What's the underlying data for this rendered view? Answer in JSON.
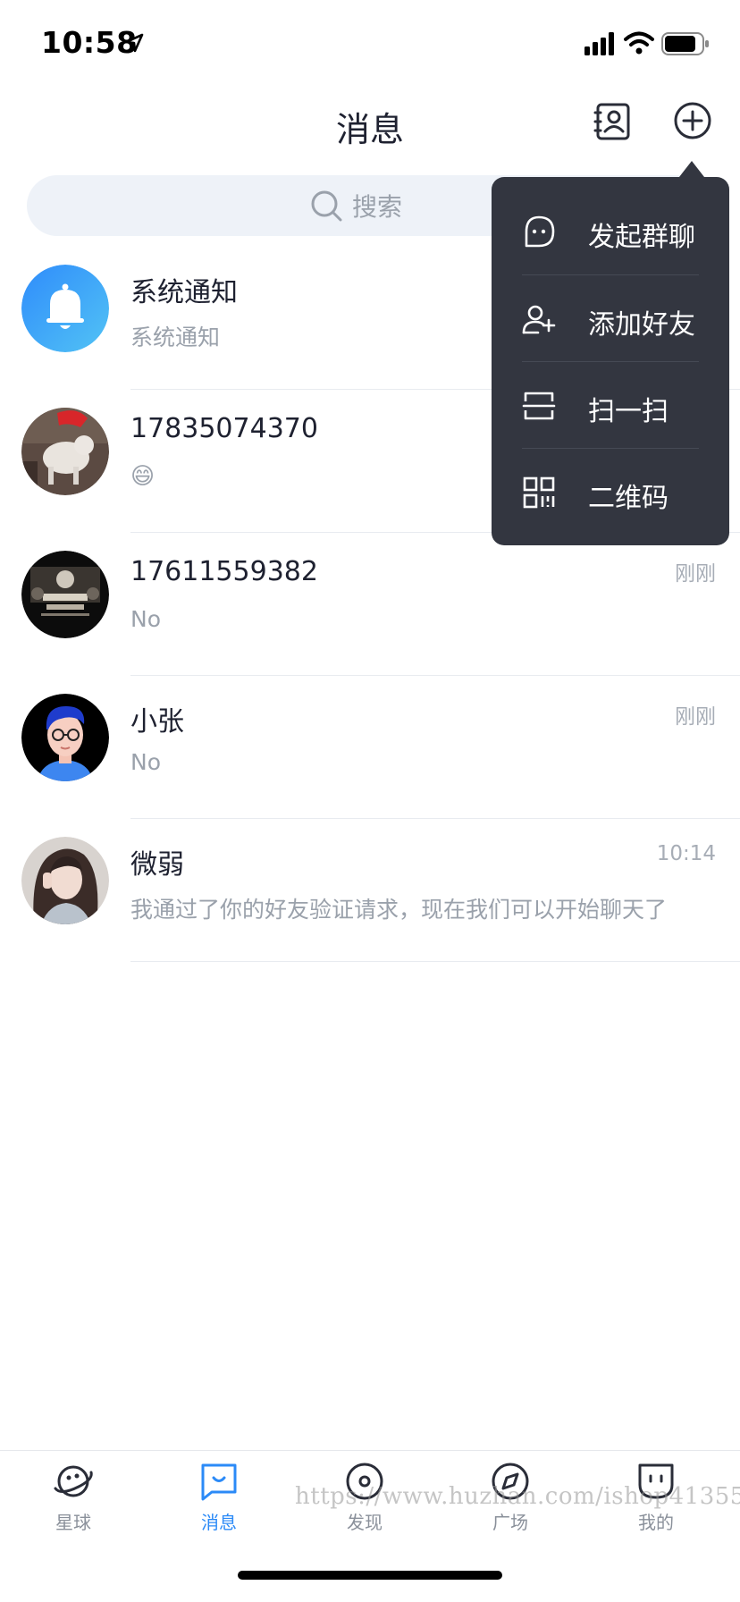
{
  "status_bar": {
    "time": "10:58"
  },
  "header": {
    "title": "消息"
  },
  "search": {
    "placeholder": "搜索"
  },
  "conversations": [
    {
      "name": "系统通知",
      "preview": "系统通知",
      "time": ""
    },
    {
      "name": "17835074370",
      "preview": "😄",
      "time": ""
    },
    {
      "name": "17611559382",
      "preview": "No",
      "time": "刚刚"
    },
    {
      "name": "小张",
      "preview": "No",
      "time": "刚刚"
    },
    {
      "name": "微弱",
      "preview": "我通过了你的好友验证请求，现在我们可以开始聊天了",
      "time": "10:14"
    }
  ],
  "popup_menu": {
    "items": [
      {
        "label": "发起群聊",
        "icon": "chat-bubble-icon"
      },
      {
        "label": "添加好友",
        "icon": "add-user-icon"
      },
      {
        "label": "扫一扫",
        "icon": "scan-icon"
      },
      {
        "label": "二维码",
        "icon": "qr-code-icon"
      }
    ]
  },
  "tab_bar": {
    "tabs": [
      {
        "label": "星球",
        "icon": "planet-icon",
        "active": false
      },
      {
        "label": "消息",
        "icon": "message-icon",
        "active": true
      },
      {
        "label": "发现",
        "icon": "discover-icon",
        "active": false
      },
      {
        "label": "广场",
        "icon": "compass-icon",
        "active": false
      },
      {
        "label": "我的",
        "icon": "profile-icon",
        "active": false
      }
    ],
    "watermark": "https://www.huzhan.com/ishop41355"
  },
  "colors": {
    "accent": "#2b8af7",
    "popup_bg": "#333640",
    "search_bg": "#eef2f8",
    "muted_text": "#9aa1ab"
  }
}
